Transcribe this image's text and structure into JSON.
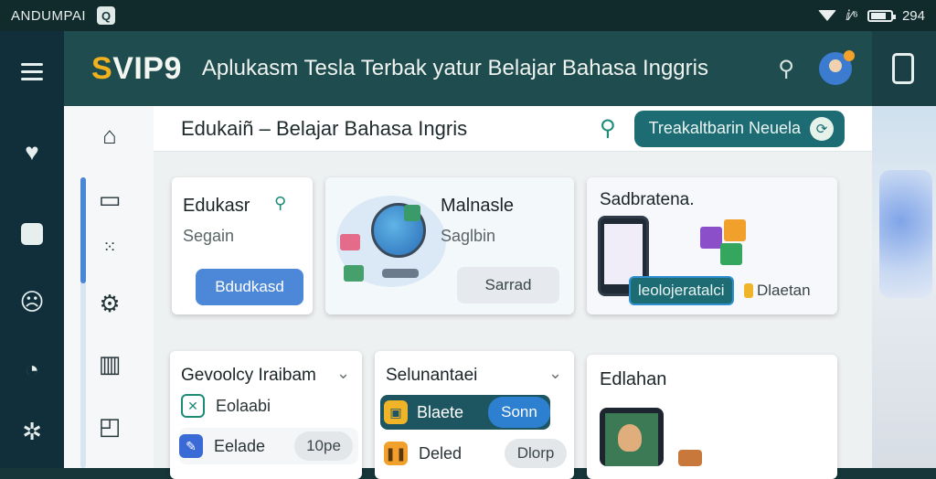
{
  "statusbar": {
    "carrier": "ANDUMPAI",
    "app_badge": "Q",
    "signal": "ⅈ⁄⁶",
    "time": "294"
  },
  "rail": {
    "icons": [
      "menu-icon",
      "heart-icon",
      "square-icon",
      "face-icon",
      "gauge-icon",
      "settings-icon"
    ]
  },
  "appbar": {
    "logo_s": "S",
    "logo_rest": "VIP9",
    "title": "Aplukasm Tesla Terbak yatur Belajar Bahasa Inggris"
  },
  "subbar": {
    "title": "Edukaiñ – Belajar Bahasa Ingris",
    "pill_label": "Treakaltbarin Neuela",
    "pill_icon": "⟳"
  },
  "cards": {
    "c1": {
      "title": "Edukasr",
      "subtitle": "Segain",
      "button": "Bdudkasd"
    },
    "c2": {
      "title": "Malnasle",
      "subtitle": "Saglbin",
      "button": "Sarrad"
    },
    "c3": {
      "title": "Sadbratena.",
      "chip_label": "leolojeratalci",
      "chip2_label": "Dlaetan"
    },
    "c4": {
      "title": "Gevoolcy Iraibam",
      "items": [
        {
          "label": "Eolaabi",
          "tag": ""
        },
        {
          "label": "Eelade",
          "tag": "10pe"
        }
      ]
    },
    "c5": {
      "title": "Selunantaei",
      "items": [
        {
          "label": "Blaete",
          "tag": "Sonn"
        },
        {
          "label": "Deled",
          "tag": "Dlorp"
        }
      ]
    },
    "c6": {
      "title": "Edlahan"
    }
  },
  "colors": {
    "accent_teal": "#1d6c73",
    "brand_yellow": "#f2b21e",
    "button_blue": "#4d88d8",
    "appbar": "#1f4d4f"
  }
}
